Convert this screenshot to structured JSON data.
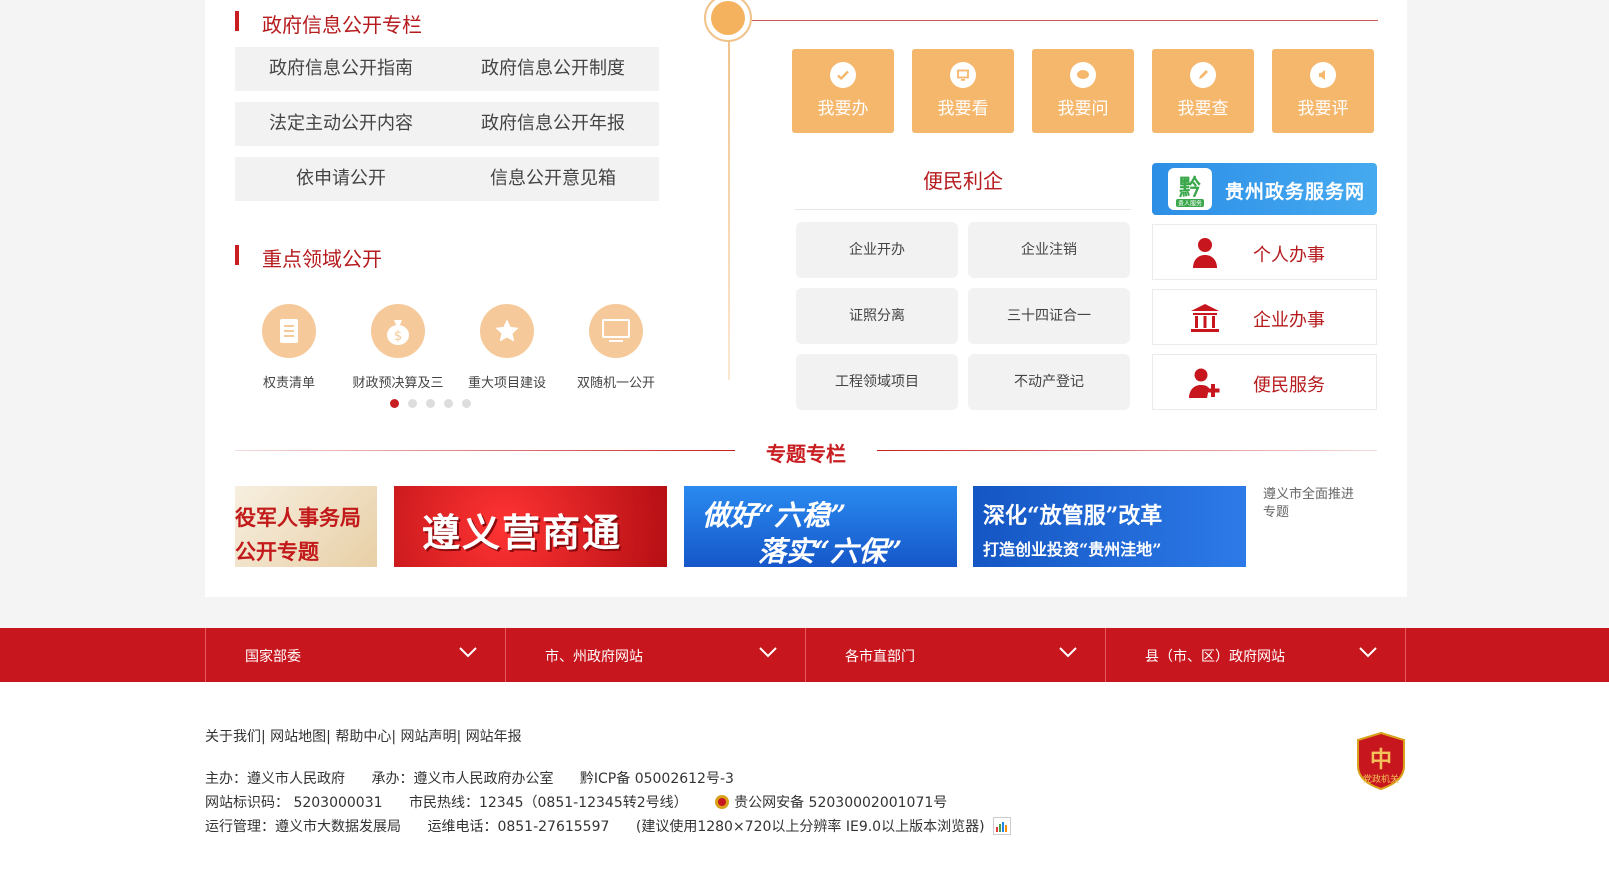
{
  "info_section": {
    "title": "政府信息公开专栏",
    "rows": [
      [
        "政府信息公开指南",
        "政府信息公开制度"
      ],
      [
        "法定主动公开内容",
        "政府信息公开年报"
      ],
      [
        "依申请公开",
        "信息公开意见箱"
      ]
    ]
  },
  "key_domains": {
    "title": "重点领域公开",
    "items": [
      {
        "label": "权责清单",
        "icon": "list-icon"
      },
      {
        "label": "财政预决算及三",
        "icon": "money-bag-icon"
      },
      {
        "label": "重大项目建设",
        "icon": "star-icon"
      },
      {
        "label": "双随机一公开",
        "icon": "monitor-icon"
      }
    ]
  },
  "actions": [
    {
      "label": "我要办",
      "icon": "check-icon"
    },
    {
      "label": "我要看",
      "icon": "screen-icon"
    },
    {
      "label": "我要问",
      "icon": "chat-icon"
    },
    {
      "label": "我要查",
      "icon": "pen-icon"
    },
    {
      "label": "我要评",
      "icon": "speaker-icon"
    }
  ],
  "convenience": {
    "title": "便民利企",
    "items": [
      "企业开办",
      "企业注销",
      "证照分离",
      "三十四证合一",
      "工程领域项目",
      "不动产登记"
    ]
  },
  "guizhou_banner": {
    "text": "贵州政务服务网",
    "logo_text": "黔",
    "logo_sub": "贵人服务"
  },
  "services": [
    {
      "label": "个人办事",
      "icon": "person-icon"
    },
    {
      "label": "企业办事",
      "icon": "building-icon"
    },
    {
      "label": "便民服务",
      "icon": "person-plus-icon"
    }
  ],
  "topics": {
    "title": "专题专栏",
    "banners": [
      {
        "line1": "役军人事务局",
        "line2": "公开专题"
      },
      {
        "line1": "遵义营商通",
        "line2": ""
      },
      {
        "line1": "做好“六稳”",
        "line2": "落实“六保”"
      },
      {
        "line1": "深化“放管服”改革",
        "line2": "打造创业投资“贵州洼地”"
      },
      {
        "line1": "遵义市全面推进",
        "line2": "专题"
      }
    ]
  },
  "nav": [
    {
      "label": "国家部委"
    },
    {
      "label": "市、州政府网站"
    },
    {
      "label": "各市直部门"
    },
    {
      "label": "县（市、区）政府网站"
    }
  ],
  "footer": {
    "links": [
      "关于我们",
      "网站地图",
      "帮助中心",
      "网站声明",
      "网站年报"
    ],
    "line1": [
      "主办：遵义市人民政府",
      "承办：遵义市人民政府办公室",
      "黔ICP备 05002612号-3"
    ],
    "line2": [
      "网站标识码： 5203000031",
      "市民热线：12345（0851-12345转2号线）",
      "贵公网安备 52030002001071号"
    ],
    "line3": [
      "运行管理：遵义市大数据发展局",
      "运维电话：0851-27615597",
      "(建议使用1280×720以上分辨率 IE9.0以上版本浏览器)"
    ],
    "badge_text": "党政机关",
    "colors": {
      "primary_red": "#c8161e",
      "accent_orange": "#f5b76b"
    }
  }
}
